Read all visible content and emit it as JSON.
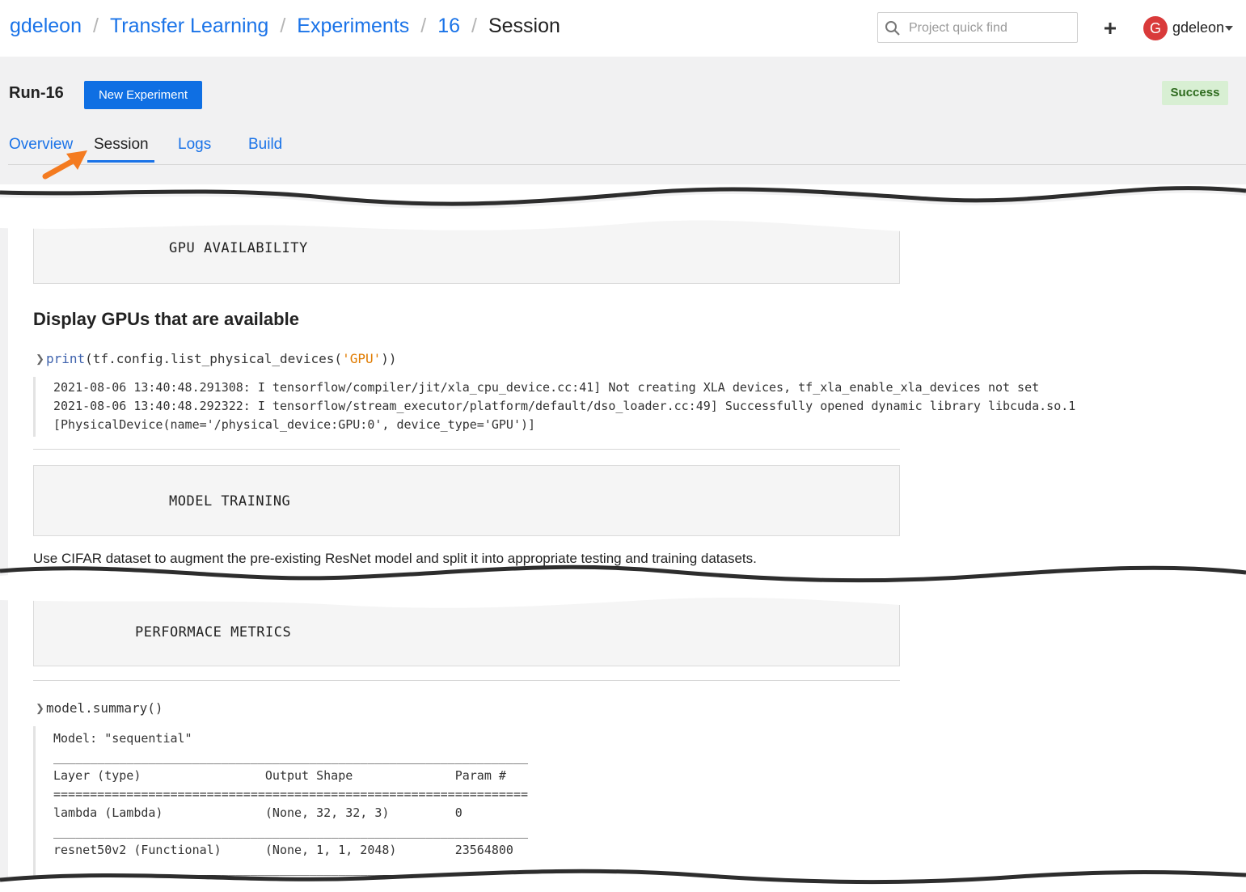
{
  "breadcrumb": {
    "items": [
      "gdeleon",
      "Transfer Learning",
      "Experiments",
      "16"
    ],
    "current": "Session",
    "separator": "/"
  },
  "search": {
    "placeholder": "Project quick find",
    "value": ""
  },
  "user": {
    "avatar_letter": "G",
    "name": "gdeleon"
  },
  "run": {
    "title": "Run-16",
    "new_experiment_label": "New Experiment",
    "status": "Success"
  },
  "tabs": [
    {
      "label": "Overview",
      "active": false
    },
    {
      "label": "Session",
      "active": true
    },
    {
      "label": "Logs",
      "active": false
    },
    {
      "label": "Build",
      "active": false
    }
  ],
  "notebook": {
    "gpu_header": "GPU AVAILABILITY",
    "gpu_heading": "Display GPUs that are available",
    "gpu_code": {
      "fn": "print",
      "mid": "(tf.config.list_physical_devices(",
      "str": "'GPU'",
      "end": "))"
    },
    "gpu_output": [
      "2021-08-06 13:40:48.291308: I tensorflow/compiler/jit/xla_cpu_device.cc:41] Not creating XLA devices, tf_xla_enable_xla_devices not set",
      "2021-08-06 13:40:48.292322: I tensorflow/stream_executor/platform/default/dso_loader.cc:49] Successfully opened dynamic library libcuda.so.1",
      "[PhysicalDevice(name='/physical_device:GPU:0', device_type='GPU')]"
    ],
    "training_header": "MODEL TRAINING",
    "training_text": "Use CIFAR dataset to augment the pre-existing ResNet model and split it into appropriate testing and training datasets.",
    "metrics_header": "PERFORMACE METRICS",
    "summary_code": "model.summary()",
    "summary_output": [
      "Model: \"sequential\"",
      "_________________________________________________________________",
      "Layer (type)                 Output Shape              Param #   ",
      "=================================================================",
      "lambda (Lambda)              (None, 32, 32, 3)         0         ",
      "_________________________________________________________________",
      "resnet50v2 (Functional)      (None, 1, 1, 2048)        23564800  ",
      "_________________________________________________________________"
    ]
  },
  "colors": {
    "link": "#1a73e8",
    "primary_button": "#0f6fe3",
    "success_bg": "#d8efd3",
    "success_text": "#2e6b1e",
    "annotation_arrow": "#f47b20",
    "avatar": "#d93a3a"
  }
}
